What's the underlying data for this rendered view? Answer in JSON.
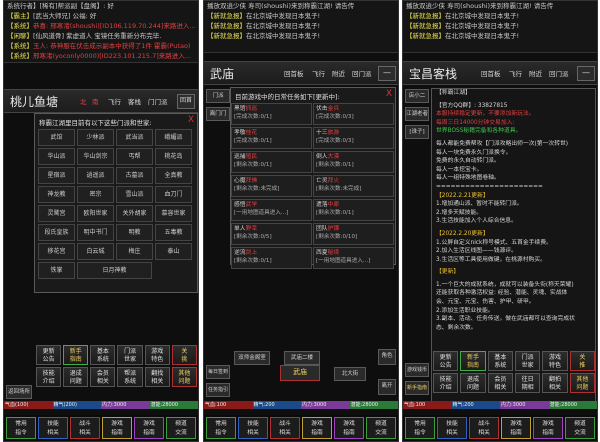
{
  "p1": {
    "chat": [
      {
        "tag": "",
        "text": "系统行者】[稀有]帮派副【盘阁】: 好"
      },
      {
        "tag": "【霸主】",
        "text": "[武当大师兄] 公福: 好"
      },
      {
        "tag": "【系统】",
        "text": "恭喜: 邢寒渚(shoushi)[ID106.119.70.244]来路进入...",
        "hl": true
      },
      {
        "tag": "【闲聊】",
        "text": "[仙风道骨] 紫虚道人 宝镜任务重新分布完毕.",
        "big": "紫虚道人"
      },
      {
        "tag": "【系统】",
        "text": "玉人: 恭神服在伏击成示副本中获得了1件 霍霸(Putao)",
        "hl": true
      },
      {
        "tag": "【系统】",
        "text": "邢寒渚(yoconly0000)[ID223.101.215.7]来路进入...",
        "hl": true
      }
    ],
    "place": "桃儿鱼塘",
    "nav": [
      "客栈",
      "飞行",
      "客栈",
      "门门派"
    ],
    "nav_arrows": [
      "北",
      "南"
    ],
    "top_btn": "回首",
    "dialog_title": "称霸江湖里目前有以下这些门派和世家:",
    "sects": [
      "武馆",
      "少林派",
      "武当派",
      "峨嵋派",
      "华山派",
      "华山剑宗",
      "丐帮",
      "桃花岛",
      "星宿派",
      "逍遥派",
      "古墓派",
      "全真教",
      "神龙教",
      "密宗",
      "雪山派",
      "血刀门",
      "灵鹫宫",
      "欧阳世家",
      "关外胡家",
      "慕容世家",
      "段氏皇族",
      "明中书门",
      "明教",
      "五毒教",
      "移花宫",
      "白云城",
      "梅庄",
      "泰山",
      "铁掌"
    ],
    "sects_wide": [
      "日月神教"
    ],
    "sect_side": "返回场所",
    "buttons": [
      [
        "更新",
        "公告"
      ],
      [
        "新手",
        "指南"
      ],
      [
        "基本",
        "系统"
      ],
      [
        "门派",
        "世家"
      ],
      [
        "游戏",
        "特色"
      ],
      [
        "关",
        "挑"
      ],
      [
        "技能",
        "介绍"
      ],
      [
        "退成",
        "问题"
      ],
      [
        "会员",
        "相关"
      ],
      [
        "帮派",
        "系统"
      ],
      [
        "翻找",
        "相关"
      ],
      [
        "其他",
        "问题"
      ]
    ],
    "stats": [
      "气血(100)",
      "精气(200)",
      "内力:3000",
      "潜能:28000"
    ],
    "bottom": [
      [
        "常用",
        "指令"
      ],
      [
        "技能",
        "相关"
      ],
      [
        "战斗",
        "相关"
      ],
      [
        "游戏",
        "指南"
      ],
      [
        "游戏",
        "指南"
      ],
      [
        "频道",
        "交流"
      ]
    ]
  },
  "p2": {
    "chat": [
      {
        "tag": "",
        "text": "播放双逍少侠 寿司(shoushi)来到称霸江湖! 请告传"
      },
      {
        "tag": "【新就急报】",
        "text": "在北京城中发现日本鬼子!"
      },
      {
        "tag": "【新就急报】",
        "text": "在北京城中发现日本鬼子!"
      },
      {
        "tag": "【新就急报】",
        "text": "在北京城中发现日本鬼子!"
      }
    ],
    "place": "武庙",
    "nav": [
      "回首板",
      "飞行",
      "附近",
      "回门派"
    ],
    "side_top": [
      "门派",
      "离门门"
    ],
    "dialog_title": "目前游戏中的日常任务如下[更新中]:",
    "tasks": [
      {
        "name": "黑馆",
        "tag": "抓巡",
        "status": "[完成次数:0/1]"
      },
      {
        "name": "伏击",
        "tag": "金兵",
        "status": "[完成次数:0/3]"
      },
      {
        "name": "孝敬",
        "tag": "桂花",
        "status": "[完成次数:0/1]"
      },
      {
        "name": "十三",
        "tag": "旅游",
        "status": "[完成次数:0/3]"
      },
      {
        "name": "巡捕",
        "tag": "殖民",
        "status": "[剩余次数:0/1]"
      },
      {
        "name": "倒人",
        "tag": "大漠",
        "status": "[剩余次数:0/1]"
      },
      {
        "name": "心魔",
        "tag": "拜佛",
        "status": "[剩余次数:未完成]"
      },
      {
        "name": "亡灵",
        "tag": "拜火",
        "status": "[剩余次数:未完成]"
      },
      {
        "name": "感悟",
        "tag": "武学",
        "status": "[一用地图道具进入...]"
      },
      {
        "name": "遗落",
        "tag": "中原",
        "status": "[剩余次数:0/1]"
      },
      {
        "name": "单人",
        "tag": "野幸",
        "status": "[剩余次数:0/5]"
      },
      {
        "name": "团队",
        "tag": "护镖",
        "status": "[剩余次数:0/10]"
      },
      {
        "name": "逆流",
        "tag": "剑上",
        "status": "[剩余次数:0/1]"
      },
      {
        "name": "西夏",
        "tag": "秘境",
        "status": "[一用地图道具进入...]"
      }
    ],
    "place_side": [
      "双师金阁室",
      "武庙二楼",
      "北大街"
    ],
    "center_btn": "武庙",
    "right_side": [
      "角色",
      "离开"
    ],
    "left_side": [
      "每日签到",
      "任务指引"
    ],
    "stats": [
      "气血:100",
      "精气:200",
      "内力:3000",
      "潜能:28000"
    ],
    "bottom": [
      [
        "常用",
        "指令"
      ],
      [
        "技能",
        "相关"
      ],
      [
        "战斗",
        "相关"
      ],
      [
        "游戏",
        "指南"
      ],
      [
        "游戏",
        "指南"
      ],
      [
        "频道",
        "交流"
      ]
    ]
  },
  "p3": {
    "chat": [
      {
        "tag": "",
        "text": "播放双逍少侠 寿司(shoushi)来到称霸江湖! 请告传"
      },
      {
        "tag": "【新就急报】",
        "text": "在北京城中发现日本鬼子!"
      },
      {
        "tag": "【新就急报】",
        "text": "在北京城中发现日本鬼子!"
      },
      {
        "tag": "【新就急报】",
        "text": "在北京城中发现日本鬼子!"
      }
    ],
    "place": "宝昌客栈",
    "nav": [
      "回首板",
      "飞行",
      "附近",
      "回门派"
    ],
    "side": [
      "店小二",
      "江湖老者",
      "[诛子]"
    ],
    "side_bottom": [
      "游戏钱币",
      "新手指南"
    ],
    "notice": [
      {
        "t": "【称霸江湖】",
        "c": ""
      },
      {
        "t": "",
        "c": ""
      },
      {
        "t": "【官方QQ群】: 33827815",
        "c": ""
      },
      {
        "t": "本服持续稳定更新，不要添加新玩法。",
        "c": "r"
      },
      {
        "t": "每周三日14000分钟交易加入:",
        "c": "r"
      },
      {
        "t": "世界BOSS秘籍完备和各种道具。",
        "c": "gr"
      },
      {
        "t": "",
        "c": ""
      },
      {
        "t": "每人都能免费帮攻【门派攻略出师一次(第一次转世)",
        "c": ""
      },
      {
        "t": "每人一块免费永久门派换令。",
        "c": ""
      },
      {
        "t": "免费的永久自动转门派。",
        "c": ""
      },
      {
        "t": "每人一本挖宝卡。",
        "c": ""
      },
      {
        "t": "每人一组特殊地图卷轴。",
        "c": ""
      },
      {
        "t": "======================",
        "c": ""
      },
      {
        "t": "【2022.2.21更新】",
        "c": "y"
      },
      {
        "t": "1.增加通山派、暂时不能转门派。",
        "c": ""
      },
      {
        "t": "2.增多天赋技能。",
        "c": ""
      },
      {
        "t": "3.生活技能加入个人综合信息。",
        "c": ""
      },
      {
        "t": "",
        "c": ""
      },
      {
        "t": "【2022.2.20更新】",
        "c": "y"
      },
      {
        "t": "1.公屏自定义nick称号模式、五首金手续费。",
        "c": ""
      },
      {
        "t": "2.加入生活区线图——钱源评。",
        "c": ""
      },
      {
        "t": "3.生活区等工具使用做键，在桃源村购买。",
        "c": ""
      },
      {
        "t": "",
        "c": ""
      },
      {
        "t": "【更新】",
        "c": "y"
      },
      {
        "t": "",
        "c": ""
      },
      {
        "t": "1.一个巨大的成就系统，成就可以装备头衔(称天荣耀)",
        "c": ""
      },
      {
        "t": "还能获取各种激活权益: 经验、潜能、灵魂、实战体",
        "c": ""
      },
      {
        "t": "会、元宝、元宝、伤害、护甲、研甲。",
        "c": ""
      },
      {
        "t": "2.添加生活职业技能。",
        "c": ""
      },
      {
        "t": "3.副本、活动、任务传送，做在武庙都可以查询完成状",
        "c": ""
      },
      {
        "t": "态、剩余次数。",
        "c": ""
      }
    ],
    "buttons": [
      [
        "更新",
        "公告"
      ],
      [
        "新手",
        "指南"
      ],
      [
        "基本",
        "系统"
      ],
      [
        "门派",
        "世家"
      ],
      [
        "游戏",
        "特色"
      ],
      [
        "关",
        "推"
      ],
      [
        "技能",
        "介绍"
      ],
      [
        "退成",
        "问题"
      ],
      [
        "会员",
        "相关"
      ],
      [
        "往日",
        "期相"
      ],
      [
        "翻拍",
        "相关"
      ],
      [
        "其他",
        "问题"
      ]
    ],
    "stats": [
      "气血:100",
      "精气:200",
      "内力:3000",
      "潜能:28000"
    ],
    "bottom": [
      [
        "常用",
        "指令"
      ],
      [
        "技能",
        "相关"
      ],
      [
        "战斗",
        "相关"
      ],
      [
        "游戏",
        "指南"
      ],
      [
        "游戏",
        "指南"
      ],
      [
        "频道",
        "交流"
      ]
    ]
  }
}
